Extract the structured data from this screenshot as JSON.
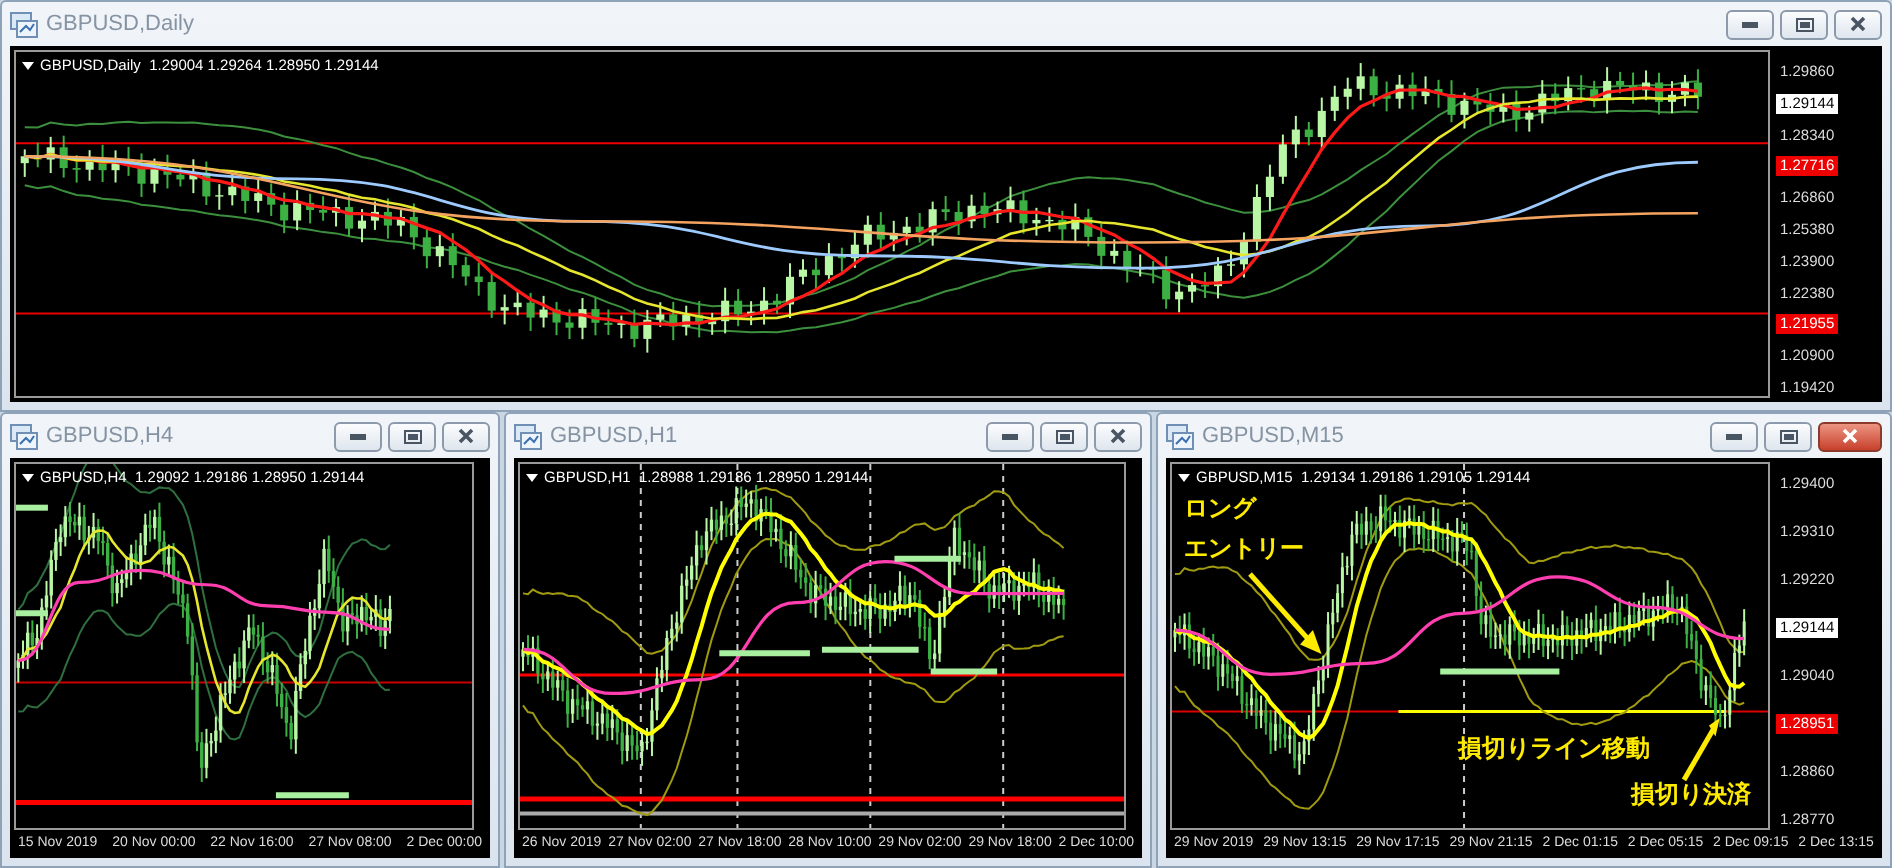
{
  "windows": [
    {
      "title": "GBPUSD,Daily",
      "active": false,
      "info": "GBPUSD,Daily  1.29004 1.29264 1.28950 1.29144",
      "price_labels": [
        {
          "text": "1.29860",
          "kind": "tick"
        },
        {
          "text": "1.29144",
          "kind": "current"
        },
        {
          "text": "1.28340",
          "kind": "tick"
        },
        {
          "text": "1.27716",
          "kind": "line"
        },
        {
          "text": "1.26860",
          "kind": "tick"
        },
        {
          "text": "1.25380",
          "kind": "tick"
        },
        {
          "text": "1.23900",
          "kind": "tick"
        },
        {
          "text": "1.22380",
          "kind": "tick"
        },
        {
          "text": "1.21955",
          "kind": "line"
        },
        {
          "text": "1.20900",
          "kind": "tick"
        },
        {
          "text": "1.19420",
          "kind": "tick"
        }
      ]
    },
    {
      "title": "GBPUSD,H4",
      "active": false,
      "info": "GBPUSD,H4  1.29092 1.29186 1.28950 1.29144",
      "time_labels": [
        "15 Nov 2019",
        "20 Nov 00:00",
        "22 Nov 16:00",
        "27 Nov 08:00",
        "2 Dec 00:00"
      ]
    },
    {
      "title": "GBPUSD,H1",
      "active": false,
      "info": "GBPUSD,H1  1.28988 1.29186 1.28950 1.29144",
      "time_labels": [
        "26 Nov 2019",
        "27 Nov 02:00",
        "27 Nov 18:00",
        "28 Nov 10:00",
        "29 Nov 02:00",
        "29 Nov 18:00",
        "2 Dec 10:00"
      ]
    },
    {
      "title": "GBPUSD,M15",
      "active": true,
      "info": "GBPUSD,M15  1.29134 1.29186 1.29105 1.29144",
      "price_labels": [
        {
          "text": "1.29400",
          "kind": "tick"
        },
        {
          "text": "1.29310",
          "kind": "tick"
        },
        {
          "text": "1.29220",
          "kind": "tick"
        },
        {
          "text": "1.29144",
          "kind": "current"
        },
        {
          "text": "1.29040",
          "kind": "tick"
        },
        {
          "text": "1.28951",
          "kind": "line"
        },
        {
          "text": "1.28860",
          "kind": "tick"
        },
        {
          "text": "1.28770",
          "kind": "tick"
        }
      ],
      "time_labels": [
        "29 Nov 2019",
        "29 Nov 13:15",
        "29 Nov 17:15",
        "29 Nov 21:15",
        "2 Dec 01:15",
        "2 Dec 05:15",
        "2 Dec 09:15",
        "2 Dec 13:15"
      ],
      "annotations": [
        {
          "text": "ロング"
        },
        {
          "text": "エントリー"
        },
        {
          "text": "損切りライン移動"
        },
        {
          "text": "損切り決済"
        }
      ]
    }
  ]
}
